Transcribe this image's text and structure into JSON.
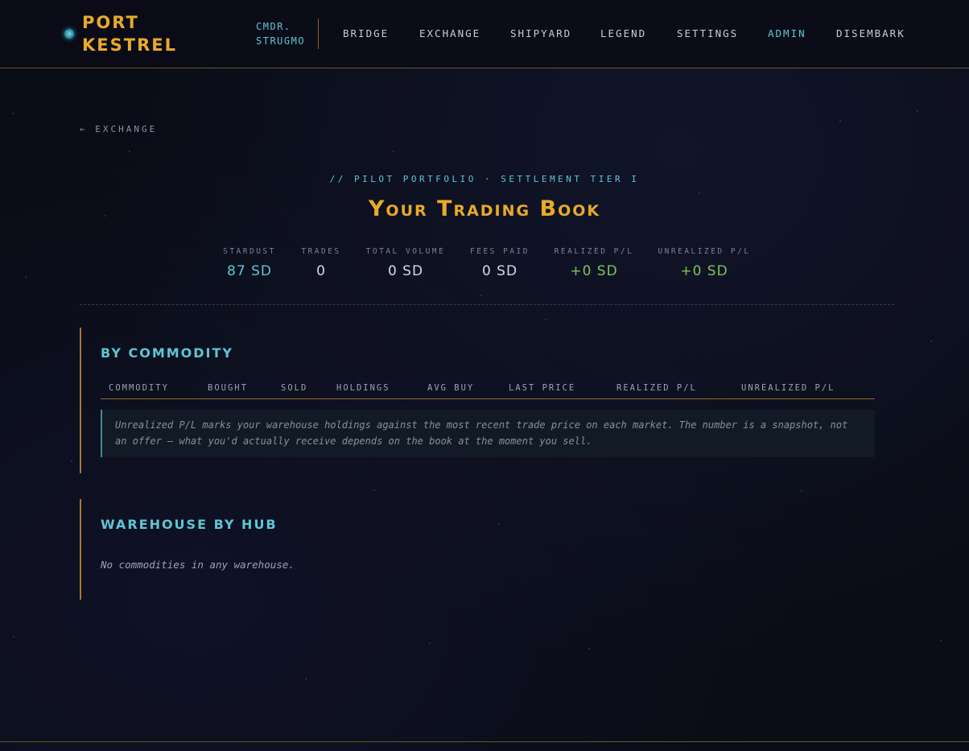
{
  "brand": {
    "line1": "PORT",
    "line2": "KESTREL"
  },
  "commander": {
    "line1": "CMDR.",
    "line2": "STRUGMO"
  },
  "nav": [
    {
      "label": "BRIDGE"
    },
    {
      "label": "EXCHANGE"
    },
    {
      "label": "SHIPYARD"
    },
    {
      "label": "LEGEND"
    },
    {
      "label": "SETTINGS"
    },
    {
      "label": "ADMIN",
      "active": true
    },
    {
      "label": "DISEMBARK"
    }
  ],
  "back_link": "← EXCHANGE",
  "kicker": "// PILOT PORTFOLIO · SETTLEMENT TIER I",
  "page_title": "Your Trading Book",
  "stats": [
    {
      "label": "STARDUST",
      "value": "87 SD",
      "tone": "cyan"
    },
    {
      "label": "TRADES",
      "value": "0",
      "tone": "plain"
    },
    {
      "label": "TOTAL VOLUME",
      "value": "0 SD",
      "tone": "plain"
    },
    {
      "label": "FEES PAID",
      "value": "0 SD",
      "tone": "plain"
    },
    {
      "label": "REALIZED P/L",
      "value": "+0 SD",
      "tone": "green"
    },
    {
      "label": "UNREALIZED P/L",
      "value": "+0 SD",
      "tone": "green"
    }
  ],
  "by_commodity": {
    "heading": "By Commodity",
    "columns": [
      "COMMODITY",
      "BOUGHT",
      "SOLD",
      "HOLDINGS",
      "AVG BUY",
      "LAST PRICE",
      "REALIZED P/L",
      "UNREALIZED P/L"
    ],
    "note": "Unrealized P/L marks your warehouse holdings against the most recent trade price on each market. The number is a snapshot, not an offer — what you'd actually receive depends on the book at the moment you sell."
  },
  "warehouse": {
    "heading": "Warehouse by Hub",
    "empty_text": "No commodities in any warehouse."
  },
  "colors": {
    "accent_gold": "#e9a92a",
    "accent_cyan": "#5ec6d3",
    "positive_green": "#7cc45a",
    "background": "#0a0c16"
  }
}
